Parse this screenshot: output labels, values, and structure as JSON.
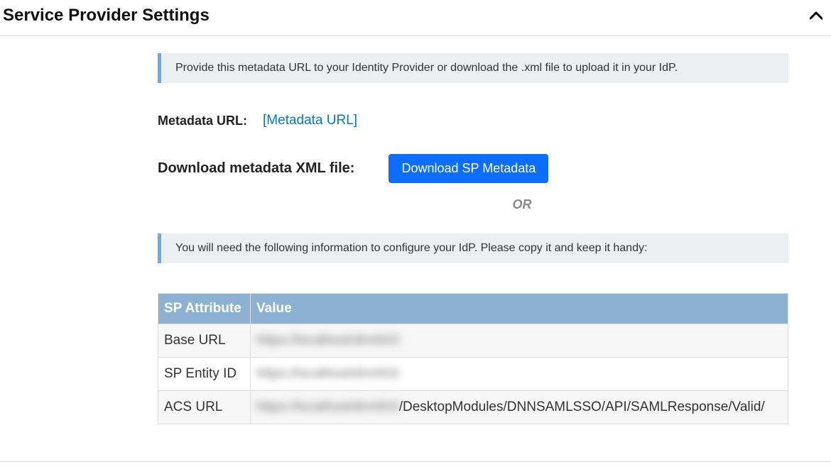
{
  "header": {
    "title": "Service Provider Settings"
  },
  "info1": "Provide this metadata URL to your Identity Provider or download the .xml file to upload it in your IdP.",
  "metadata": {
    "label": "Metadata URL:",
    "link_text": "[Metadata URL]"
  },
  "download": {
    "label": "Download metadata XML file:",
    "button": "Download SP Metadata"
  },
  "or_text": "OR",
  "info2": "You will need the following information to configure your IdP. Please copy it and keep it handy:",
  "table": {
    "header_attr": "SP Attribute",
    "header_value": "Value",
    "rows": [
      {
        "attr": "Base URL",
        "blurred": "https://localhost/dnn910",
        "suffix": ""
      },
      {
        "attr": "SP Entity ID",
        "blurred": "https://localhost/dnn910",
        "suffix": ""
      },
      {
        "attr": "ACS URL",
        "blurred": "https://localhost/dnn910",
        "suffix": "/DesktopModules/DNNSAMLSSO/API/SAMLResponse/Valid/"
      }
    ]
  }
}
